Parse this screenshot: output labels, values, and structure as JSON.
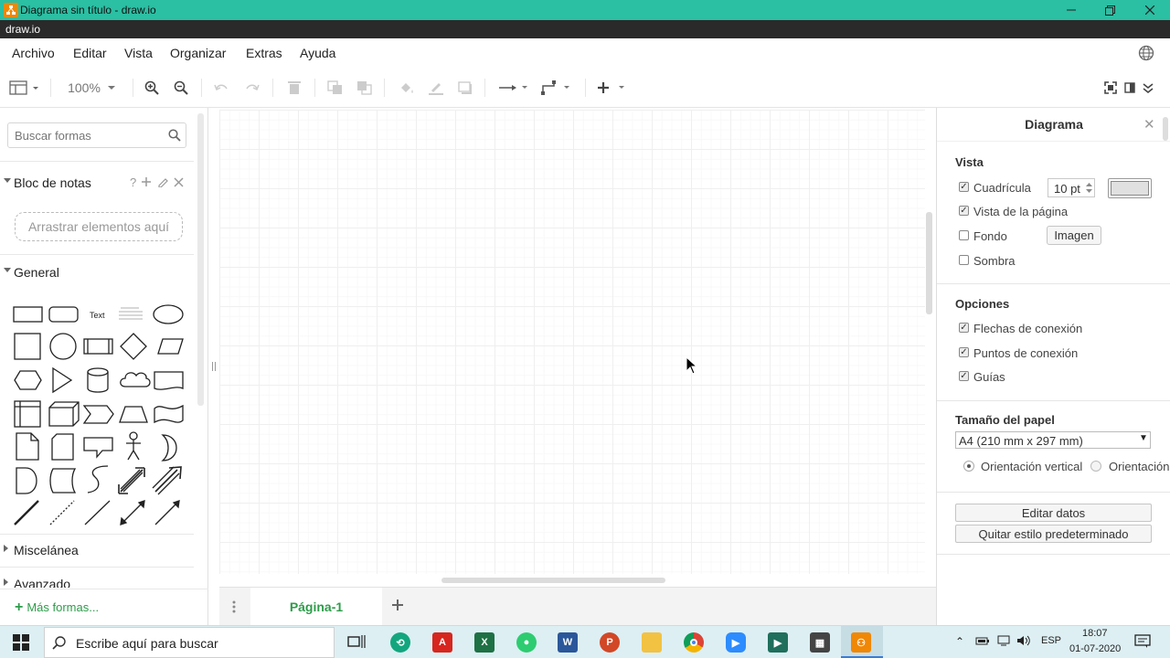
{
  "window": {
    "title": "Diagrama sin título - draw.io",
    "app_name": "draw.io"
  },
  "menu": [
    "Archivo",
    "Editar",
    "Vista",
    "Organizar",
    "Extras",
    "Ayuda"
  ],
  "toolbar": {
    "zoom": "100%"
  },
  "sidebar": {
    "search_placeholder": "Buscar formas",
    "scratchpad_title": "Bloc de notas",
    "scratchpad_drop": "Arrastrar elementos aquí",
    "general_title": "General",
    "text_shape_label": "Text",
    "misc_title": "Miscelánea",
    "advanced_title": "Avanzado",
    "more_shapes": "Más formas..."
  },
  "pages": {
    "active_tab": "Página-1"
  },
  "format_panel": {
    "title": "Diagrama",
    "view": {
      "heading": "Vista",
      "grid_label": "Cuadrícula",
      "grid_checked": true,
      "grid_size": "10 pt",
      "page_view_label": "Vista de la página",
      "page_view_checked": true,
      "background_label": "Fondo",
      "background_checked": false,
      "image_button": "Imagen",
      "shadow_label": "Sombra",
      "shadow_checked": false
    },
    "options": {
      "heading": "Opciones",
      "connection_arrows": "Flechas de conexión",
      "connection_points": "Puntos de conexión",
      "guides": "Guías"
    },
    "paper": {
      "heading": "Tamaño del papel",
      "size": "A4 (210 mm x 297 mm)",
      "portrait": "Orientación vertical",
      "landscape": "Orientación",
      "selected": "portrait"
    },
    "edit_data_button": "Editar datos",
    "clear_style_button": "Quitar estilo predeterminado"
  },
  "taskbar": {
    "search_placeholder": "Escribe aquí para buscar",
    "language": "ESP",
    "time": "18:07",
    "date": "01-07-2020"
  }
}
